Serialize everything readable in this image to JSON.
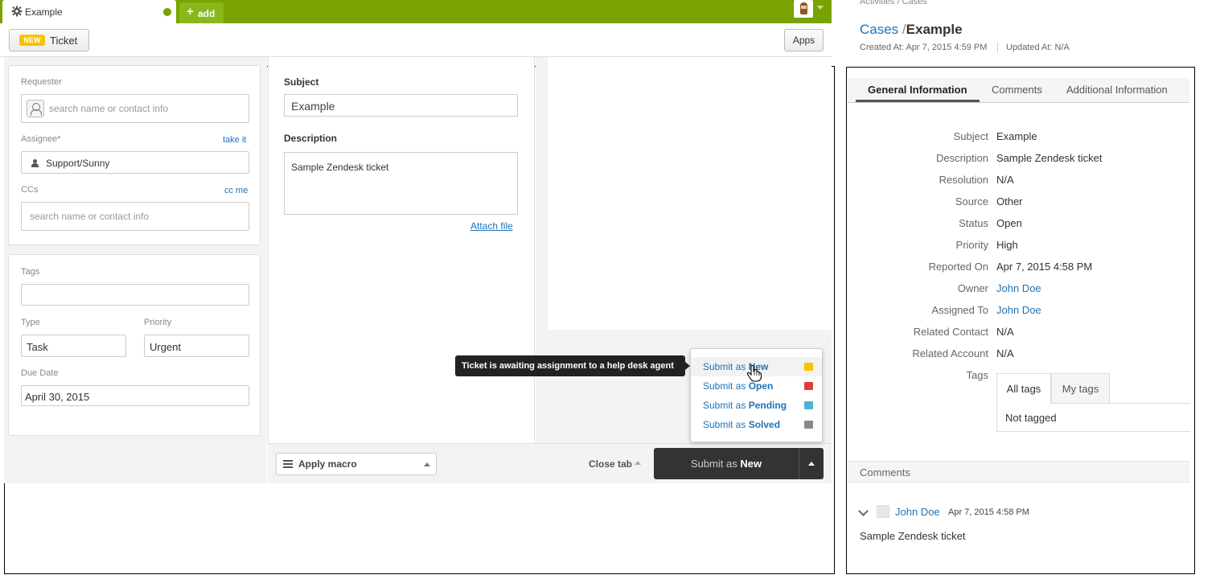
{
  "zendesk": {
    "tab": {
      "title": "Example",
      "add_label": "add"
    },
    "toolbar": {
      "badge": "NEW",
      "ticket_label": "Ticket",
      "apps_label": "Apps"
    },
    "requester": {
      "label": "Requester",
      "placeholder": "search name or contact info"
    },
    "assignee": {
      "label": "Assignee*",
      "action": "take it",
      "value": "Support/Sunny"
    },
    "ccs": {
      "label": "CCs",
      "action": "cc me",
      "placeholder": "search name or contact info"
    },
    "tags": {
      "label": "Tags",
      "value": ""
    },
    "type": {
      "label": "Type",
      "value": "Task"
    },
    "priority": {
      "label": "Priority",
      "value": "Urgent"
    },
    "due_date": {
      "label": "Due Date",
      "value": "April 30, 2015"
    },
    "subject": {
      "label": "Subject",
      "value": "Example"
    },
    "description": {
      "label": "Description",
      "value": "Sample Zendesk ticket"
    },
    "attach_label": "Attach file",
    "footer": {
      "macro_label": "Apply macro",
      "close_tab_label": "Close tab",
      "submit_prefix": "Submit as ",
      "submit_status": "New"
    },
    "tooltip": "Ticket is awaiting assignment to a help desk agent",
    "submit_options": [
      {
        "prefix": "Submit as ",
        "status": "New",
        "color": "#f5c300"
      },
      {
        "prefix": "Submit as ",
        "status": "Open",
        "color": "#e33c3c"
      },
      {
        "prefix": "Submit as ",
        "status": "Pending",
        "color": "#4bb5d4"
      },
      {
        "prefix": "Submit as ",
        "status": "Solved",
        "color": "#888888"
      }
    ],
    "colors": {
      "topbar": "#78a300",
      "link": "#1f73b7"
    }
  },
  "crm": {
    "breadcrumb": "Activities / Cases",
    "title": {
      "parent": "Cases",
      "separator": "/",
      "name": "Example"
    },
    "created": "Created At: Apr 7, 2015 4:59 PM",
    "updated": "Updated At: N/A",
    "tabs": [
      "General Information",
      "Comments",
      "Additional Information"
    ],
    "fields": [
      {
        "label": "Subject",
        "value": "Example"
      },
      {
        "label": "Description",
        "value": "Sample Zendesk ticket"
      },
      {
        "label": "Resolution",
        "value": "N/A"
      },
      {
        "label": "Source",
        "value": "Other"
      },
      {
        "label": "Status",
        "value": "Open"
      },
      {
        "label": "Priority",
        "value": "High"
      },
      {
        "label": "Reported On",
        "value": "Apr 7, 2015 4:58 PM"
      },
      {
        "label": "Owner",
        "value": "John Doe"
      },
      {
        "label": "Assigned To",
        "value": "John Doe"
      },
      {
        "label": "Related Contact",
        "value": "N/A"
      },
      {
        "label": "Related Account",
        "value": "N/A"
      },
      {
        "label": "Tags",
        "value": ""
      }
    ],
    "tag_tabs": [
      "All tags",
      "My tags"
    ],
    "tags_empty": "Not tagged",
    "comments_header": "Comments",
    "comment": {
      "author": "John Doe",
      "date": "Apr 7, 2015 4:58 PM",
      "body": "Sample Zendesk ticket"
    }
  }
}
